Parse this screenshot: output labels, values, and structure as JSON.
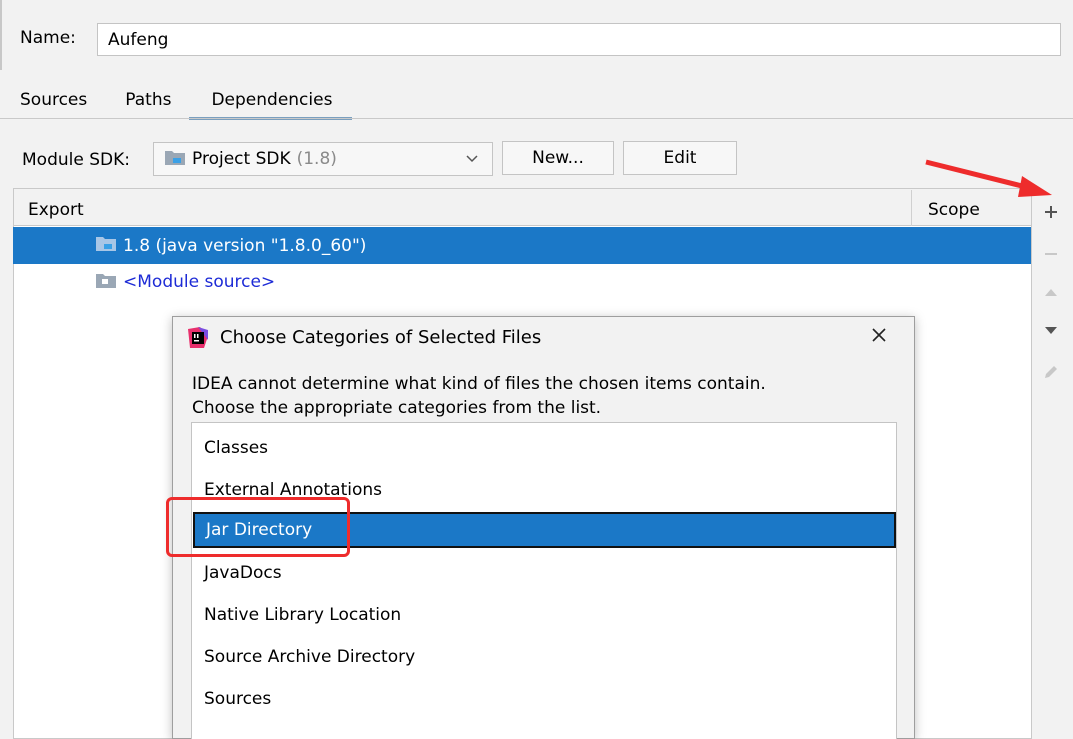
{
  "name_field": {
    "label": "Name:",
    "value": "Aufeng"
  },
  "tabs": [
    {
      "label": "Sources",
      "active": false
    },
    {
      "label": "Paths",
      "active": false
    },
    {
      "label": "Dependencies",
      "active": true
    }
  ],
  "sdk": {
    "label": "Module SDK:",
    "selected": "Project SDK",
    "selected_version": "(1.8)",
    "new_button": "New...",
    "edit_button": "Edit"
  },
  "dependencies_table": {
    "columns": [
      "Export",
      "Scope"
    ],
    "rows": [
      {
        "label": "1.8 (java version \"1.8.0_60\")",
        "icon": "jdk-folder-icon",
        "selected": true
      },
      {
        "label": "<Module source>",
        "icon": "module-source-folder-icon",
        "selected": false
      }
    ]
  },
  "toolbar": {
    "add": "plus-icon",
    "remove": "minus-icon",
    "move_up": "arrow-up-icon",
    "move_down": "arrow-down-icon",
    "edit": "pencil-icon"
  },
  "dialog": {
    "title": "Choose Categories of Selected Files",
    "message_line1": "IDEA cannot determine what kind of files the chosen items contain.",
    "message_line2": "Choose the appropriate categories from the list.",
    "items": [
      {
        "label": "Classes",
        "selected": false
      },
      {
        "label": "External Annotations",
        "selected": false
      },
      {
        "label": "Jar Directory",
        "selected": true
      },
      {
        "label": "JavaDocs",
        "selected": false
      },
      {
        "label": "Native Library Location",
        "selected": false
      },
      {
        "label": "Source Archive Directory",
        "selected": false
      },
      {
        "label": "Sources",
        "selected": false
      }
    ]
  },
  "colors": {
    "selection": "#1b78c7",
    "annotation_red": "#ee2c2c",
    "link_blue": "#1d2bd6"
  }
}
